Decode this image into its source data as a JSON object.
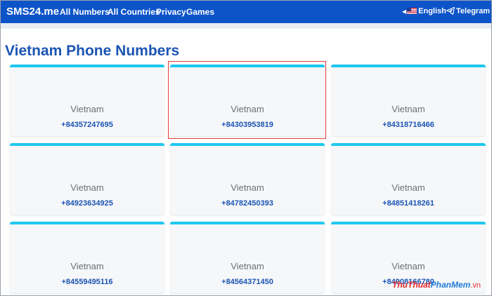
{
  "navbar": {
    "brand": "SMS24.me",
    "links": [
      "All Numbers",
      "All Countries",
      "Privacy",
      "Games"
    ],
    "language": "English",
    "telegram": "Telegram"
  },
  "page": {
    "title": "Vietnam Phone Numbers"
  },
  "numbers": [
    {
      "country": "Vietnam",
      "number": "+84357247695"
    },
    {
      "country": "Vietnam",
      "number": "+84303953819"
    },
    {
      "country": "Vietnam",
      "number": "+84318716466"
    },
    {
      "country": "Vietnam",
      "number": "+84923634925"
    },
    {
      "country": "Vietnam",
      "number": "+84782450393"
    },
    {
      "country": "Vietnam",
      "number": "+84851418261"
    },
    {
      "country": "Vietnam",
      "number": "+84559495116"
    },
    {
      "country": "Vietnam",
      "number": "+84564371450"
    },
    {
      "country": "Vietnam",
      "number": "+84908166780"
    }
  ],
  "watermark": {
    "part1": "ThuThuat",
    "part2": "PhanMem",
    "part3": ".vn"
  },
  "colors": {
    "navbar": "#0d54c9",
    "accent_bar": "#1fc8ef",
    "title": "#1b55b4",
    "highlight": "#e23b3b"
  }
}
